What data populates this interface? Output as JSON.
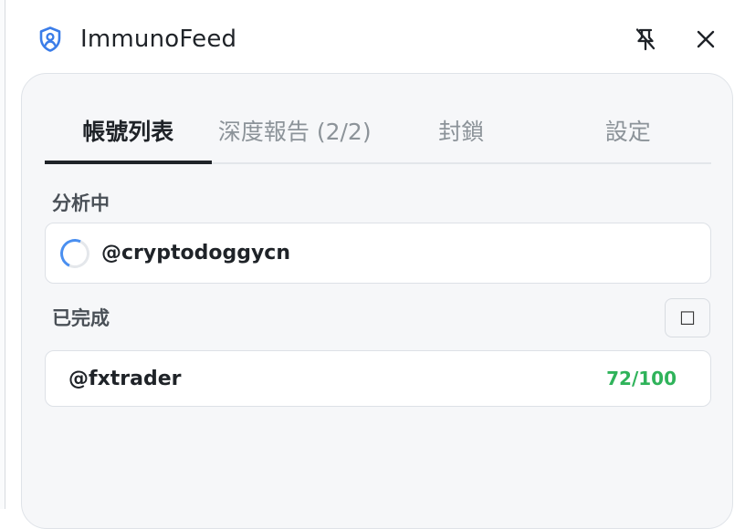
{
  "app": {
    "title": "ImmunoFeed",
    "brand_color": "#3b7de9",
    "icons": {
      "brand": "shield-user-icon",
      "unpin": "pin-off-icon",
      "close": "close-icon"
    }
  },
  "tabs": [
    {
      "label": "帳號列表",
      "active": true
    },
    {
      "label": "深度報告 (2/2)",
      "active": false
    },
    {
      "label": "封鎖",
      "active": false
    },
    {
      "label": "設定",
      "active": false
    }
  ],
  "analyzing": {
    "label": "分析中",
    "items": [
      {
        "handle": "@cryptodoggycn"
      }
    ]
  },
  "completed": {
    "label": "已完成",
    "select_all_glyph": "☐",
    "items": [
      {
        "handle": "@fxtrader",
        "score": "72/100",
        "score_color": "#2fb35a"
      }
    ]
  }
}
